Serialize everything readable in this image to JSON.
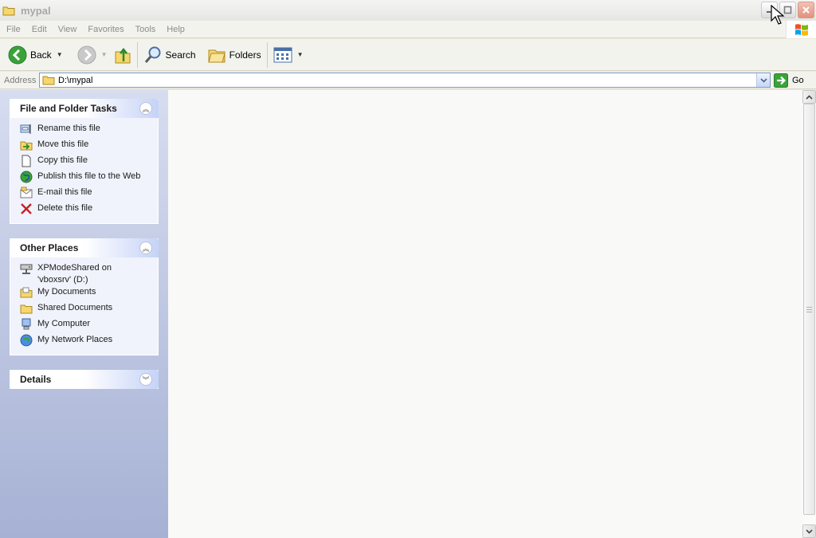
{
  "window": {
    "title": "mypal"
  },
  "menu": [
    "File",
    "Edit",
    "View",
    "Favorites",
    "Tools",
    "Help"
  ],
  "toolbar": {
    "back_label": "Back",
    "search_label": "Search",
    "folders_label": "Folders"
  },
  "address": {
    "label": "Address",
    "value": "D:\\mypal",
    "go_label": "Go"
  },
  "file_tasks": {
    "title": "File and Folder Tasks",
    "items": [
      "Rename this file",
      "Move this file",
      "Copy this file",
      "Publish this file to the Web",
      "E-mail this file",
      "Delete this file"
    ]
  },
  "other_places": {
    "title": "Other Places",
    "items": [
      "XPModeShared on 'vboxsrv' (D:)",
      "My Documents",
      "Shared Documents",
      "My Computer",
      "My Network Places"
    ]
  },
  "details": {
    "title": "Details"
  },
  "colors": {
    "accent": "#215dc6",
    "pane_bg": "#a6b1d4",
    "close": "#e2927d"
  }
}
